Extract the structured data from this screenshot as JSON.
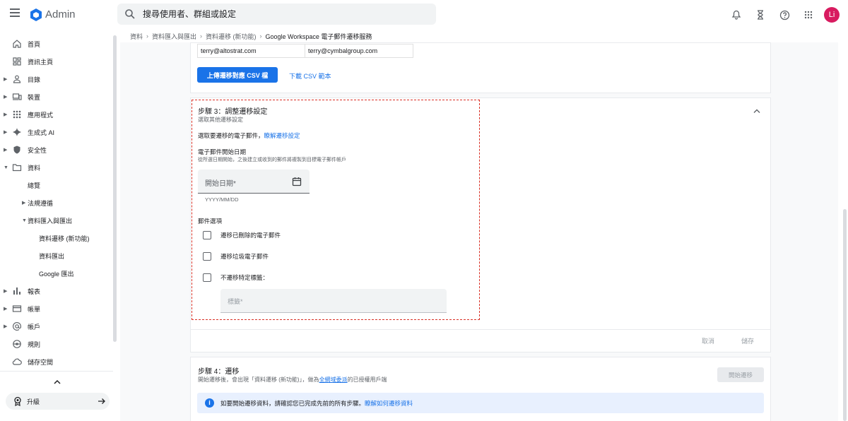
{
  "header": {
    "app_title": "Admin",
    "search_placeholder": "搜尋使用者、群組或設定",
    "avatar_initial": "Li"
  },
  "sidebar": {
    "items": [
      {
        "label": "首頁"
      },
      {
        "label": "資訊主頁"
      },
      {
        "label": "目錄"
      },
      {
        "label": "裝置"
      },
      {
        "label": "應用程式"
      },
      {
        "label": "生成式 AI"
      },
      {
        "label": "安全性"
      },
      {
        "label": "資料"
      },
      {
        "label": "總覽"
      },
      {
        "label": "法規遵循"
      },
      {
        "label": "資料匯入與匯出"
      },
      {
        "label": "資料遷移 (新功能)"
      },
      {
        "label": "資料匯出"
      },
      {
        "label": "Google 匯出"
      },
      {
        "label": "報表"
      },
      {
        "label": "帳單"
      },
      {
        "label": "帳戶"
      },
      {
        "label": "規則"
      },
      {
        "label": "儲存空間"
      }
    ],
    "upgrade_label": "升級"
  },
  "breadcrumb": [
    "資料",
    "資料匯入與匯出",
    "資料遷移 (新功能)",
    "Google Workspace 電子郵件遷移服務"
  ],
  "csv_table": {
    "row": [
      "terry@altostrat.com",
      "terry@cymbalgroup.com"
    ]
  },
  "upload_csv_label": "上傳遷移對應 CSV 檔",
  "download_csv_label": "下載 CSV 範本",
  "step3": {
    "title": "步驟 3：調整遷移設定",
    "subtitle": "選取其他遷移設定",
    "choose_text": "選取要遷移的電子郵件，",
    "learn_link": "瞭解遷移設定",
    "start_date_heading": "電子郵件開始日期",
    "start_date_desc": "從所選日期開始，之後建立或收到的郵件將複製到目標電子郵件帳戶",
    "date_label": "開始日期*",
    "date_hint": "YYYY/MM/DD",
    "mail_options_heading": "郵件選項",
    "options": [
      {
        "label": "遷移已刪除的電子郵件"
      },
      {
        "label": "遷移垃圾電子郵件"
      },
      {
        "label": "不遷移特定標籤："
      }
    ],
    "tag_placeholder": "標籤*",
    "cancel": "取消",
    "save": "儲存"
  },
  "step4": {
    "title": "步驟 4：遷移",
    "desc_prefix": "開始遷移後，會出現「資料遷移 (新功能)」，做為",
    "desc_link": "全網域委派",
    "desc_suffix": "的已授權用戶端",
    "start_button": "開始遷移",
    "info_text": "如要開始遷移資料，請確認您已完成先前的所有步驟。",
    "info_link": "瞭解如何遷移資料"
  },
  "colors": {
    "accent": "#1a73e8",
    "highlight_border": "#d93025",
    "avatar_bg": "#d81b60"
  }
}
